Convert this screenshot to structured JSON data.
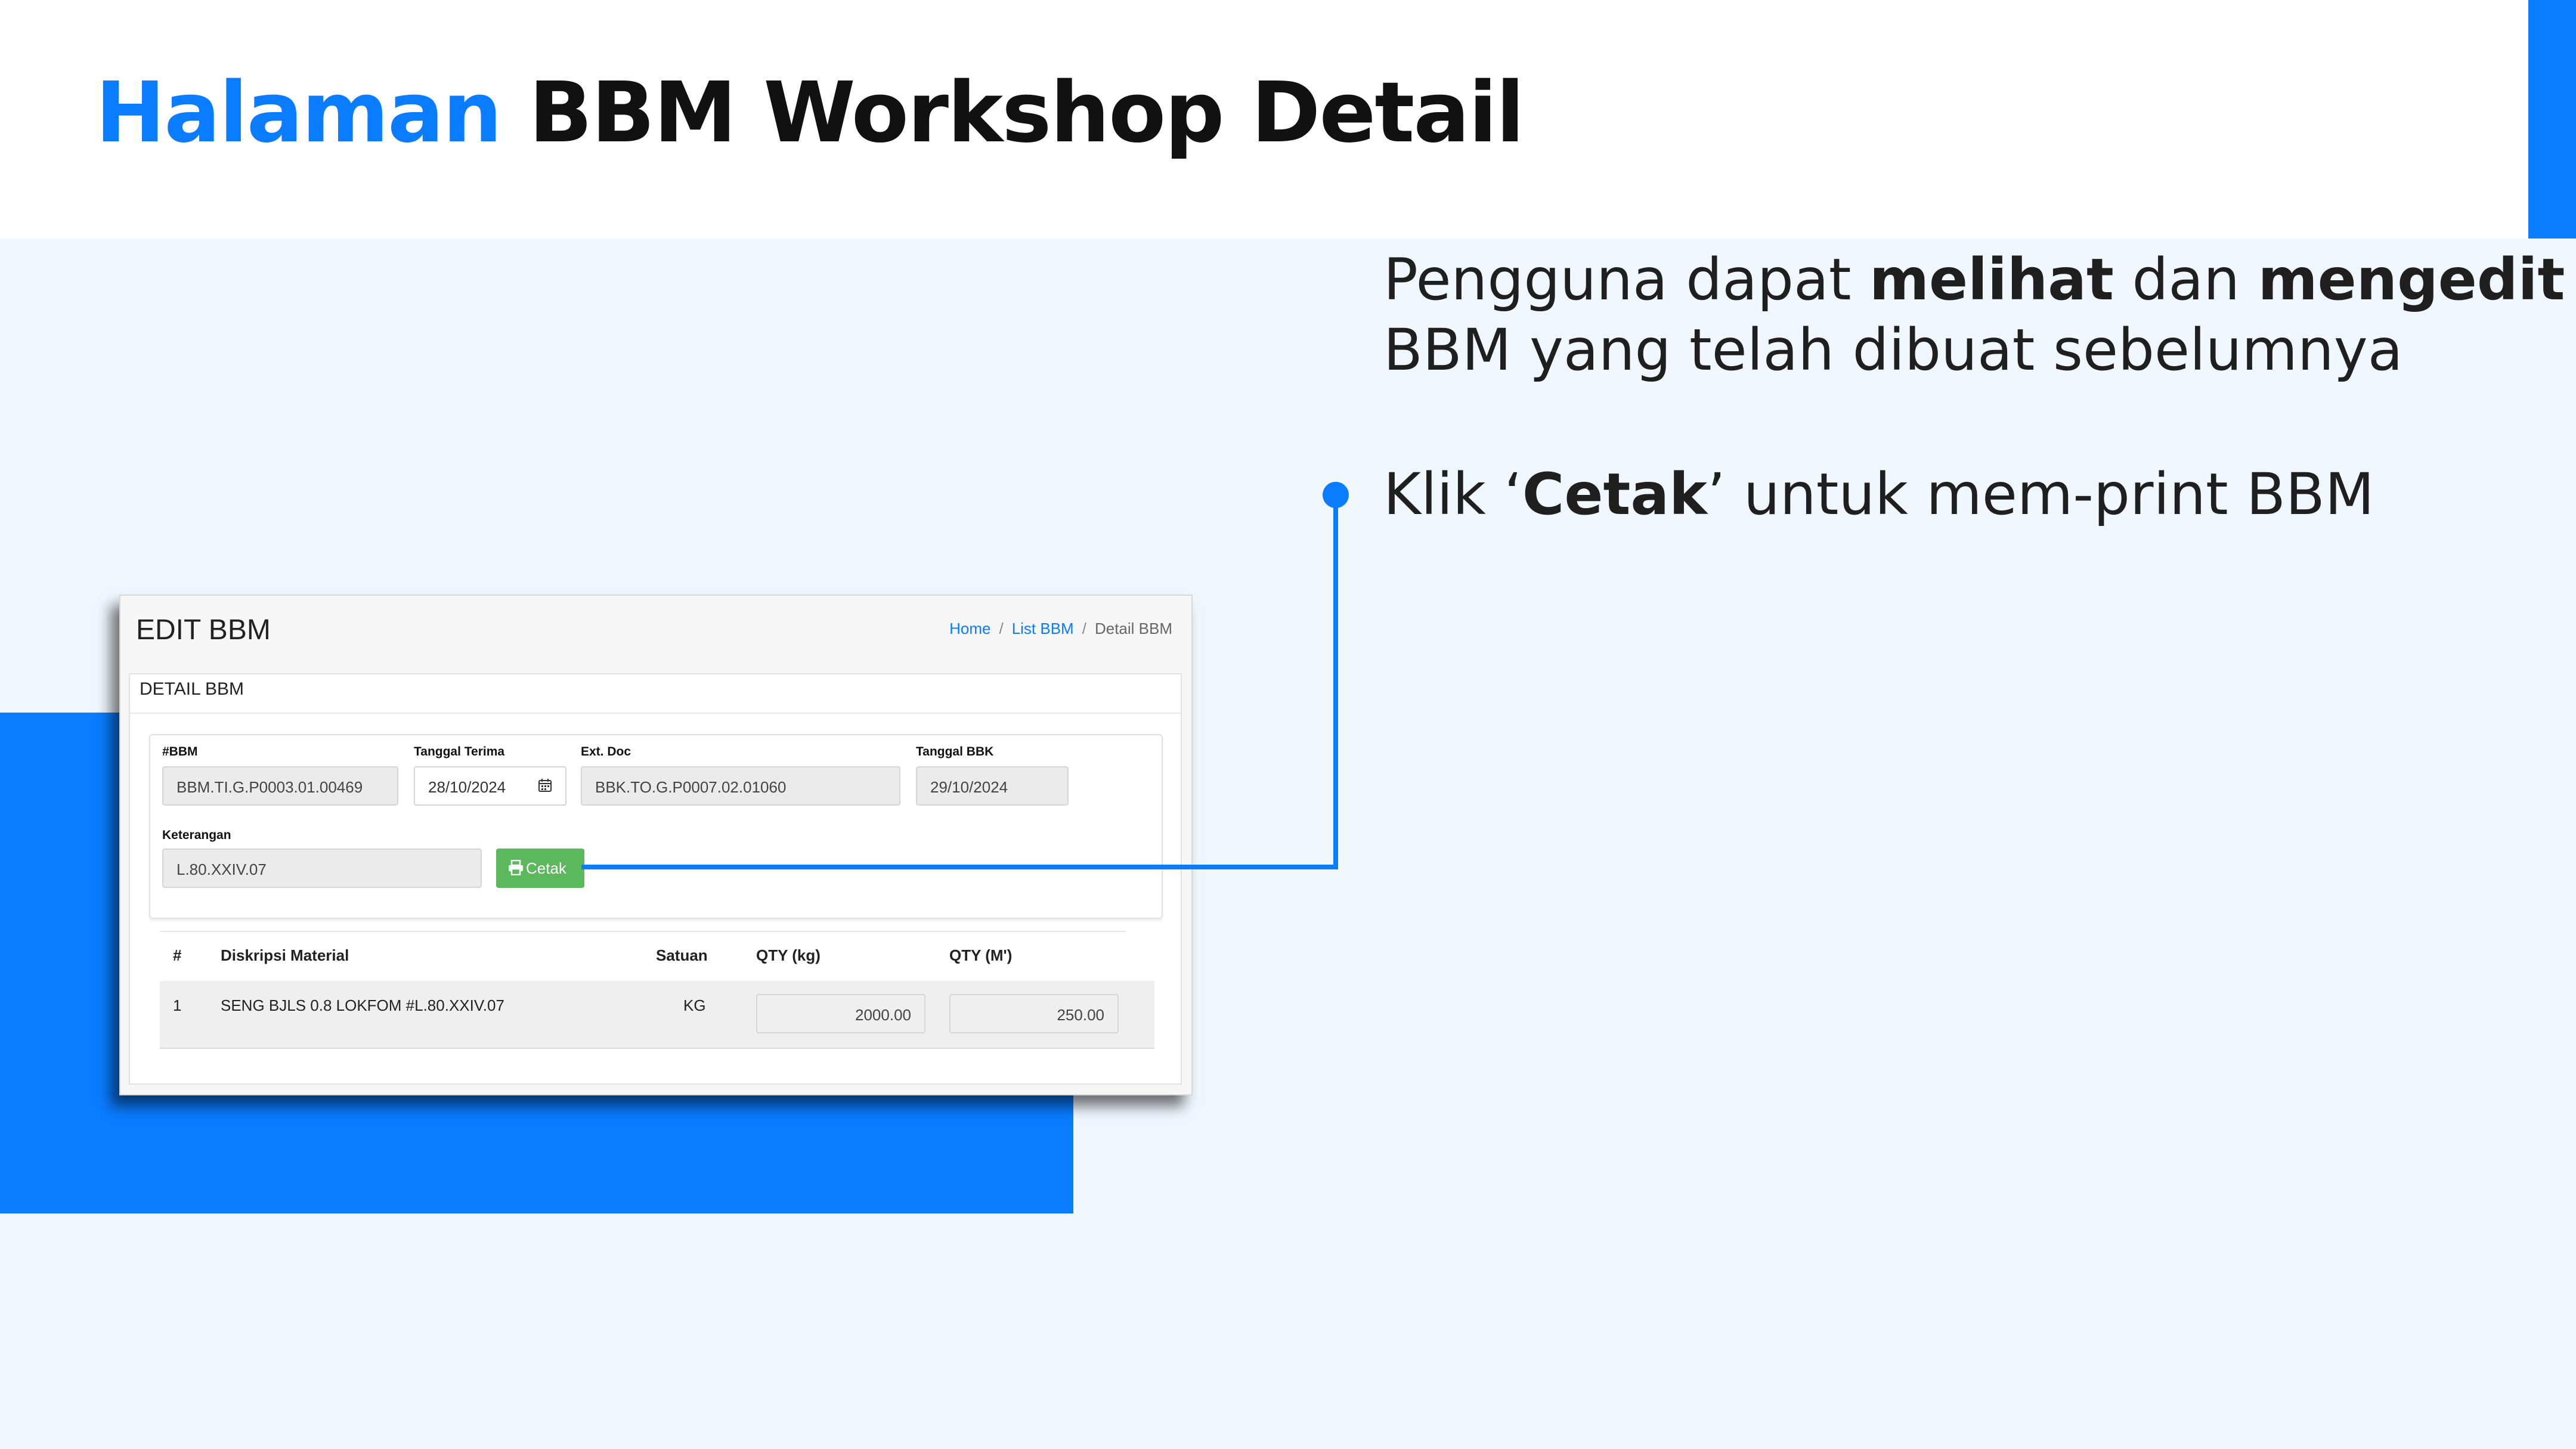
{
  "slide": {
    "title_accent": "Halaman",
    "title_rest": " BBM Workshop Detail",
    "desc_line1_a": "Pengguna dapat ",
    "desc_line1_b": "melihat",
    "desc_line1_c": " dan ",
    "desc_line1_d": "mengedit",
    "desc_line2": "BBM yang telah dibuat sebelumnya",
    "bullet_a": "Klik ‘",
    "bullet_b": "Cetak",
    "bullet_c": "’ untuk mem-print BBM",
    "accent_color": "#0a7cff"
  },
  "app": {
    "page_title": "EDIT BBM",
    "breadcrumb": {
      "home": "Home",
      "list": "List BBM",
      "current": "Detail BBM",
      "separator": "/"
    },
    "panel_title": "DETAIL BBM",
    "form": {
      "bbm_label": "#BBM",
      "bbm_value": "BBM.TI.G.P0003.01.00469",
      "tgl_terima_label": "Tanggal Terima",
      "tgl_terima_value": "28/10/2024",
      "ext_doc_label": "Ext. Doc",
      "ext_doc_value": "BBK.TO.G.P0007.02.01060",
      "tgl_bbk_label": "Tanggal BBK",
      "tgl_bbk_value": "29/10/2024",
      "keterangan_label": "Keterangan",
      "keterangan_value": "L.80.XXIV.07",
      "cetak_label": "Cetak",
      "cetak_color": "#5cb85c"
    },
    "table": {
      "headers": [
        "#",
        "Diskripsi Material",
        "Satuan",
        "QTY (kg)",
        "QTY (M')"
      ],
      "rows": [
        {
          "no": "1",
          "material": "SENG BJLS 0.8 LOKFOM #L.80.XXIV.07",
          "satuan": "KG",
          "qty_kg": "2000.00",
          "qty_m": "250.00"
        }
      ]
    }
  }
}
